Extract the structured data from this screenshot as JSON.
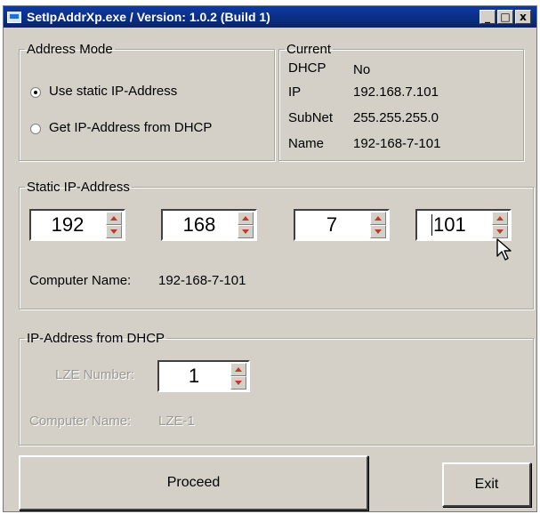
{
  "window": {
    "title": "SetIpAddrXp.exe / Version: 1.0.2 (Build 1)",
    "controls": {
      "minimize": "_",
      "maximize": "□",
      "close": "x"
    }
  },
  "address_mode": {
    "legend": "Address Mode",
    "options": [
      {
        "label": "Use static IP-Address",
        "checked": true
      },
      {
        "label": "Get IP-Address from DHCP",
        "checked": false
      }
    ]
  },
  "current": {
    "legend": "Current",
    "rows": [
      {
        "key": "DHCP",
        "value": "No"
      },
      {
        "key": "IP",
        "value": "192.168.7.101"
      },
      {
        "key": "SubNet",
        "value": "255.255.255.0"
      },
      {
        "key": "Name",
        "value": "192-168-7-101"
      }
    ]
  },
  "static_ip": {
    "legend": "Static IP-Address",
    "octets": [
      "192",
      "168",
      "7",
      "101"
    ],
    "computer_name_label": "Computer Name:",
    "computer_name_value": "192-168-7-101"
  },
  "dhcp": {
    "legend": "IP-Address from DHCP",
    "lze_label": "LZE Number:",
    "lze_value": "1",
    "computer_name_label": "Computer Name:",
    "computer_name_value": "LZE-1"
  },
  "buttons": {
    "proceed": "Proceed",
    "exit": "Exit"
  },
  "colors": {
    "titlebar": "#0a246a",
    "face": "#d4d0c8",
    "arrow": "#c0392b"
  }
}
